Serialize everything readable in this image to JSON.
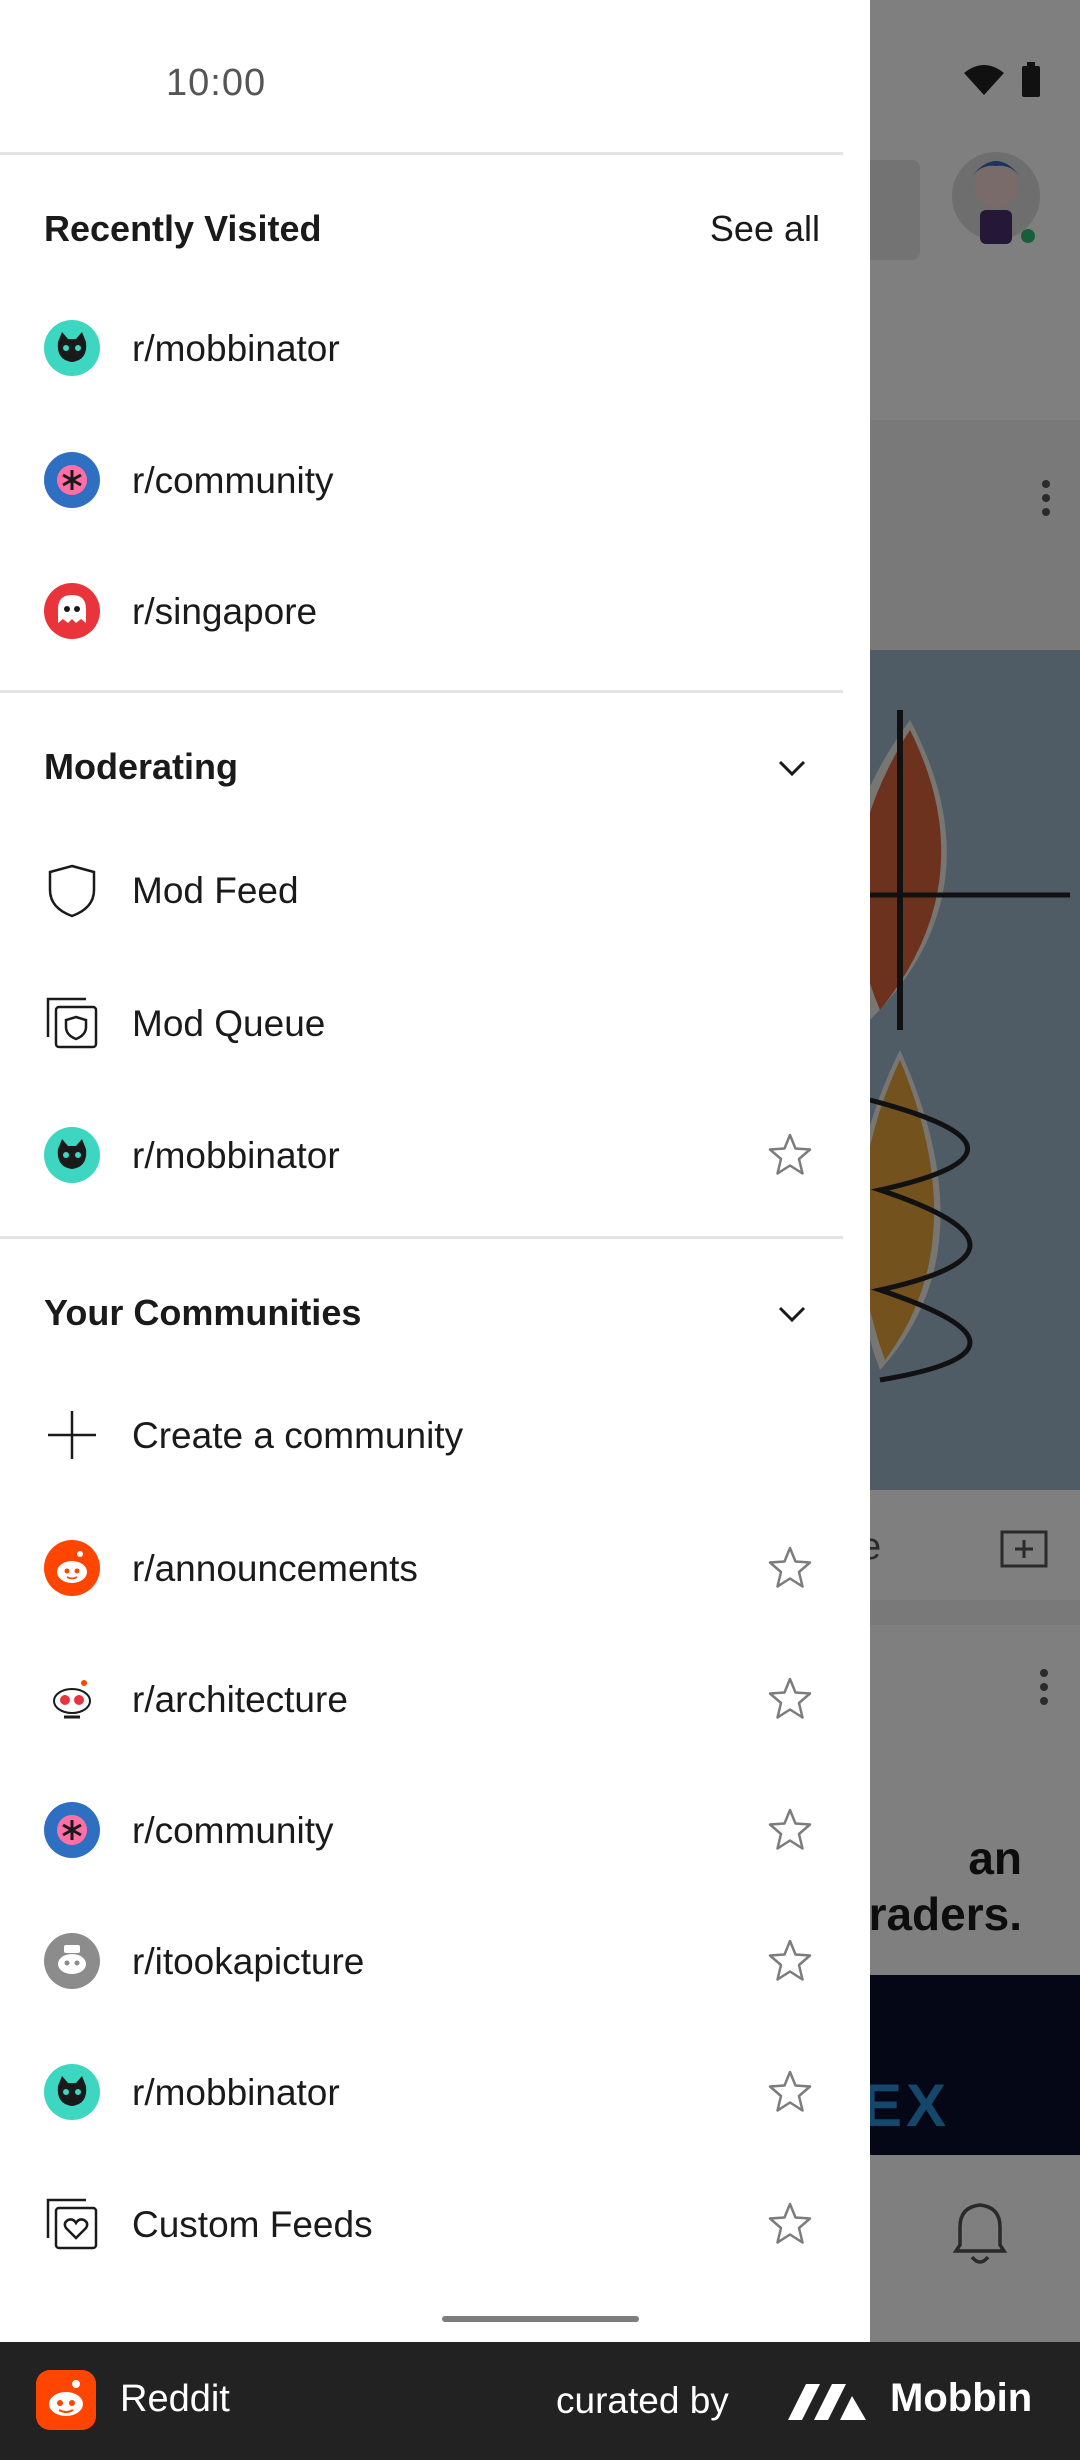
{
  "status_bar": {
    "time": "10:00"
  },
  "drawer": {
    "recently_visited": {
      "title": "Recently Visited",
      "see_all": "See all",
      "items": [
        {
          "label": "r/mobbinator",
          "icon": "cat-icon",
          "color": "#3dd6c0"
        },
        {
          "label": "r/community",
          "icon": "asterisk-icon",
          "color": "#2f6fc2"
        },
        {
          "label": "r/singapore",
          "icon": "ghost-icon",
          "color": "#e8343a"
        }
      ]
    },
    "moderating": {
      "title": "Moderating",
      "items": [
        {
          "label": "Mod Feed",
          "icon": "shield-icon"
        },
        {
          "label": "Mod Queue",
          "icon": "mod-queue-icon"
        },
        {
          "label": "r/mobbinator",
          "icon": "cat-icon",
          "favorite": false
        }
      ]
    },
    "your_communities": {
      "title": "Your Communities",
      "create_label": "Create a community",
      "items": [
        {
          "label": "r/announcements",
          "icon": "reddit-snoo-icon",
          "color": "#ff4500"
        },
        {
          "label": "r/architecture",
          "icon": "snoo-robot-icon",
          "color": "#ffffff"
        },
        {
          "label": "r/community",
          "icon": "asterisk-icon",
          "color": "#2f6fc2"
        },
        {
          "label": "r/itookapicture",
          "icon": "camera-snoo-icon",
          "color": "#8c8c8c"
        },
        {
          "label": "r/mobbinator",
          "icon": "cat-icon",
          "color": "#3dd6c0"
        },
        {
          "label": "Custom Feeds",
          "icon": "custom-feeds-icon",
          "color": "#ffffff"
        }
      ]
    }
  },
  "background": {
    "ad_text_line1": "an",
    "ad_text_line2": "raders.",
    "ad_brand_fragment": "EX",
    "action_fragment": "e"
  },
  "footer": {
    "app_name": "Reddit",
    "curated_by": "curated by",
    "brand": "Mobbin"
  }
}
